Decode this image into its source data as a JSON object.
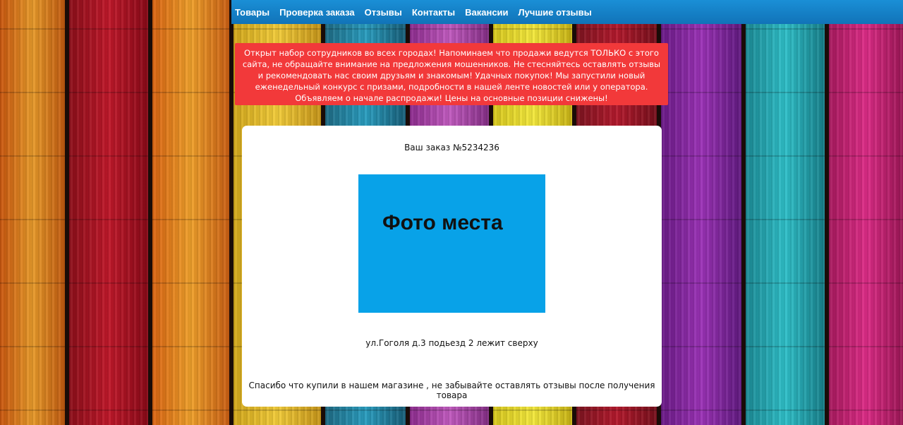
{
  "nav": {
    "items": [
      {
        "label": "Товары"
      },
      {
        "label": "Проверка заказа"
      },
      {
        "label": "Отзывы"
      },
      {
        "label": "Контакты"
      },
      {
        "label": "Вакансии"
      },
      {
        "label": "Лучшие отзывы"
      }
    ]
  },
  "alert": {
    "text": "Открыт набор сотрудников во всех городах! Напоминаем что продажи ведутся ТОЛЬКО с этого сайта, не обращайте внимание на предложения мошенников. Не стесняйтесь оставлять отзывы и рекомендовать нас своим друзьям и знакомым! Удачных покупок! Мы запустили новый еженедельный конкурс с призами, подробности в нашей ленте новостей или у оператора. Объявляем о начале распродажи! Цены на основные позиции снижены!"
  },
  "order": {
    "title": "Ваш заказ №5234236",
    "photo_label": "Фото места",
    "address": "ул.Гоголя д.3 подьезд 2 лежит сверху",
    "thanks": "Спасибо что купили в нашем магазине , не забывайте оставлять отзывы после получения товара"
  },
  "colors": {
    "nav_bg": "#1583c9",
    "alert_bg": "#f2393a",
    "photo_bg": "#08a2e8",
    "card_bg": "#ffffff"
  }
}
